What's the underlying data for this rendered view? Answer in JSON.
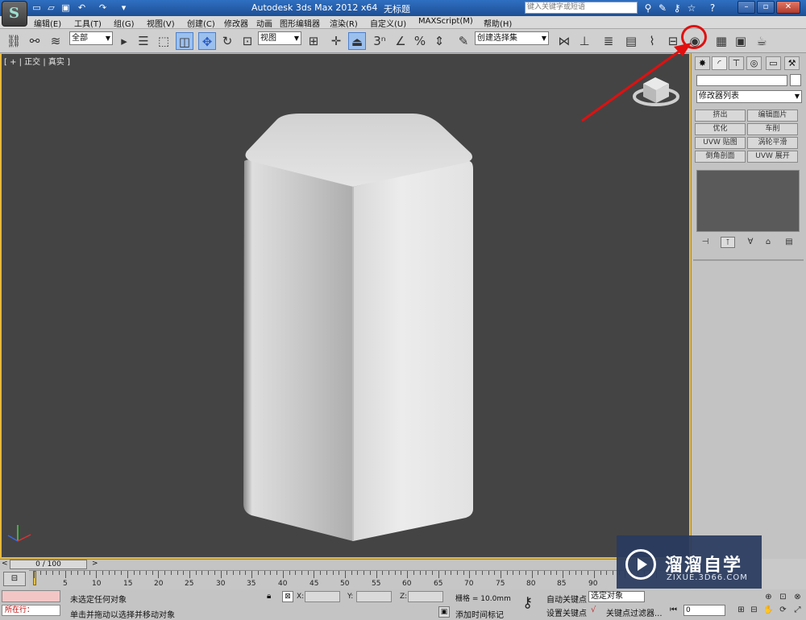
{
  "app": {
    "title": "Autodesk 3ds Max  2012 x64",
    "document": "无标题",
    "search_placeholder": "键入关键字或短语"
  },
  "menus": [
    "编辑(E)",
    "工具(T)",
    "组(G)",
    "视图(V)",
    "创建(C)",
    "修改器",
    "动画",
    "图形编辑器",
    "渲染(R)",
    "自定义(U)",
    "MAXScript(M)",
    "帮助(H)"
  ],
  "toolbar": {
    "selection_filter": "全部",
    "ref_coord": "视图",
    "named_selection": "创建选择集"
  },
  "viewport": {
    "label": "[ + | 正交 | 真实 ]",
    "accent_color": "#e7b93c",
    "bg_color": "#444444"
  },
  "command_panel": {
    "modifier_list": "修改器列表",
    "modifier_buttons": [
      "挤出",
      "编辑面片",
      "优化",
      "车削",
      "UVW 贴图",
      "涡轮平滑",
      "倒角剖面",
      "UVW 展开"
    ]
  },
  "timeline": {
    "position": "0 / 100",
    "ticks": [
      "5",
      "10",
      "15",
      "20",
      "25",
      "30",
      "35",
      "40",
      "45",
      "50",
      "55",
      "60",
      "65",
      "70",
      "75",
      "80",
      "85",
      "90"
    ]
  },
  "status": {
    "listener_text": "所在行：",
    "message1": "未选定任何对象",
    "message2": "单击并拖动以选择并移动对象",
    "x_label": "X:",
    "y_label": "Y:",
    "z_label": "Z:",
    "grid": "栅格 = 10.0mm",
    "add_time_tag": "添加时间标记",
    "auto_key": "自动关键点",
    "set_key": "设置关键点",
    "selected": "选定对象",
    "key_filters": "关键点过滤器...",
    "frame": "0"
  },
  "watermark": {
    "name": "溜溜自学",
    "url": "ZIXUE.3D66.COM"
  }
}
